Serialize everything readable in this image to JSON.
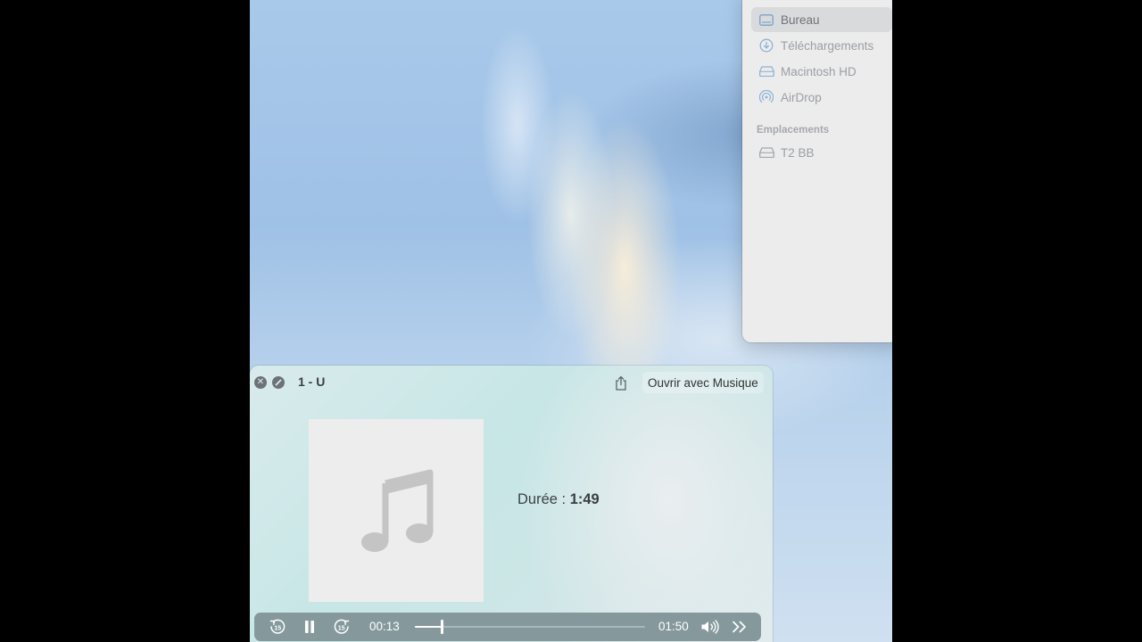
{
  "finder": {
    "items": [
      {
        "label": "Bureau",
        "icon": "desktop-icon",
        "selected": true
      },
      {
        "label": "Téléchargements",
        "icon": "download-icon",
        "selected": false
      },
      {
        "label": "Macintosh HD",
        "icon": "hard-drive-icon",
        "selected": false
      },
      {
        "label": "AirDrop",
        "icon": "airdrop-icon",
        "selected": false
      }
    ],
    "section_locations": "Emplacements",
    "locations": [
      {
        "label": "T2 BB",
        "icon": "external-drive-icon"
      }
    ]
  },
  "player": {
    "title": "1 - U",
    "open_with_label": "Ouvrir avec Musique",
    "duration_label": "Durée : ",
    "duration_value": "1:49",
    "artwork_icon": "music-note-icon",
    "controls": {
      "skip_back_seconds": "15",
      "skip_forward_seconds": "15",
      "elapsed": "00:13",
      "total": "01:50",
      "progress_fraction": 0.118
    }
  },
  "colors": {
    "controls_bar": "#85999c",
    "selection": "#d9dadc",
    "sidebar_text": "#9a9ea4"
  }
}
